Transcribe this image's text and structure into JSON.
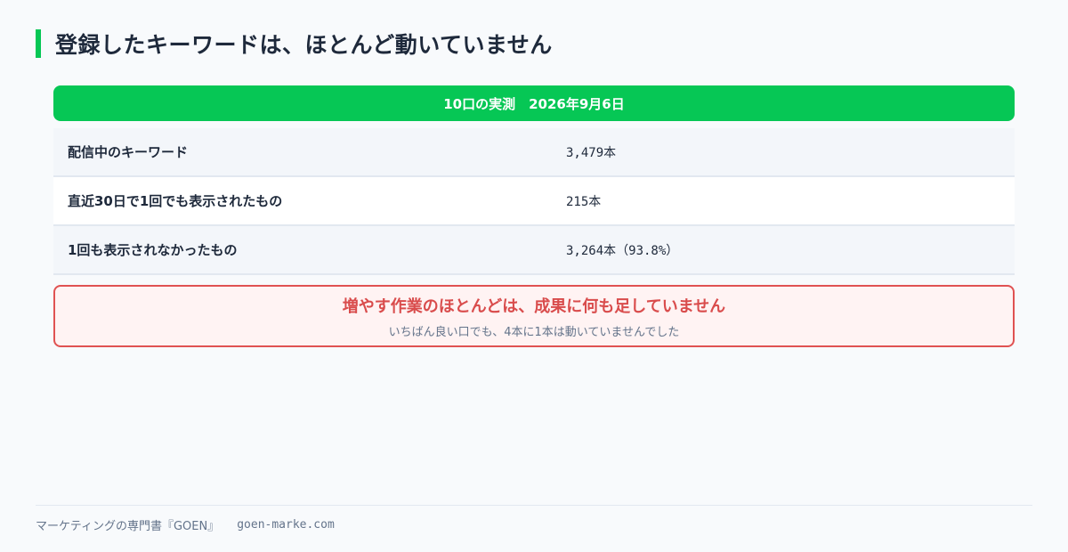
{
  "page": {
    "title": "登録したキーワードは、ほとんど動いていません"
  },
  "table": {
    "header": "10口の実測　2026年9月6日",
    "rows": [
      {
        "label": "配信中のキーワード",
        "value": "3,479本"
      },
      {
        "label": "直近30日で1回でも表示されたもの",
        "value": "215本"
      },
      {
        "label": "1回も表示されなかったもの",
        "value": "3,264本（93.8%）"
      }
    ]
  },
  "alert": {
    "title": "増やす作業のほとんどは、成果に何も足していません",
    "subtitle": "いちばん良い口でも、4本に1本は動いていませんでした"
  },
  "footer": {
    "brand": "マーケティングの専門書『GOEN』",
    "url": "goen-marke.com"
  },
  "colors": {
    "accent": "#06c755",
    "alert": "#d94c4c"
  }
}
